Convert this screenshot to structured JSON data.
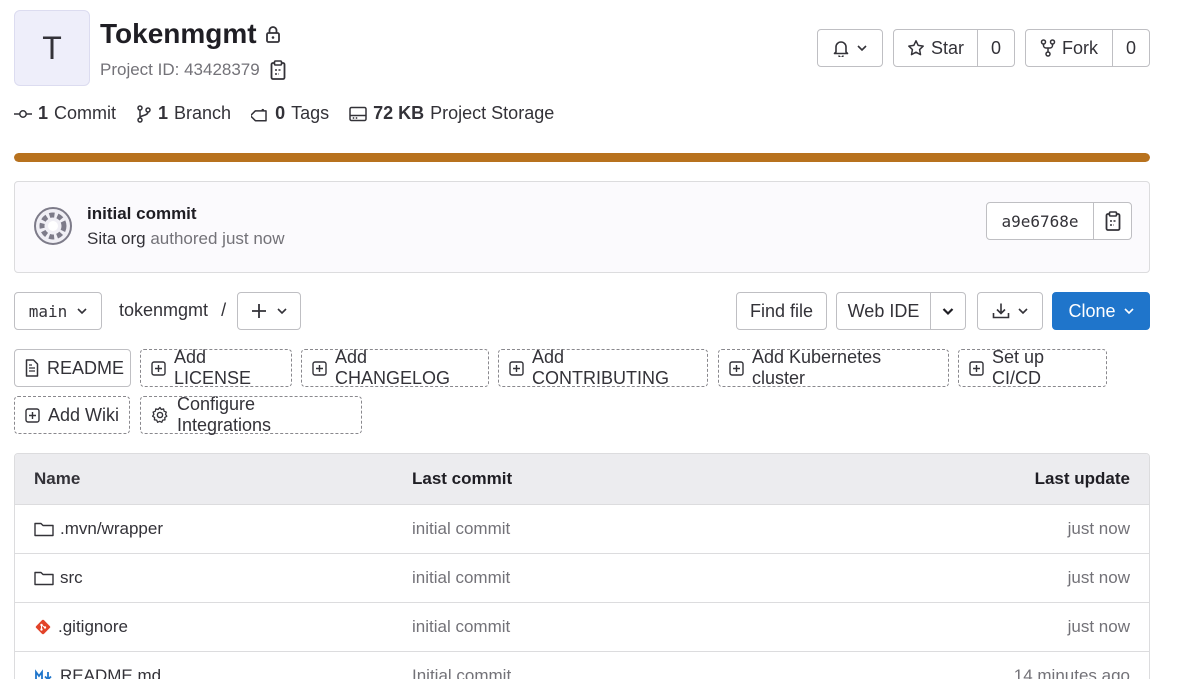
{
  "project": {
    "avatar_letter": "T",
    "name": "Tokenmgmt",
    "id_label": "Project ID: 43428379"
  },
  "header_actions": {
    "star_label": "Star",
    "star_count": "0",
    "fork_label": "Fork",
    "fork_count": "0"
  },
  "stats": {
    "commits_count": "1",
    "commits_label": "Commit",
    "branches_count": "1",
    "branches_label": "Branch",
    "tags_count": "0",
    "tags_label": "Tags",
    "storage_size": "72 KB",
    "storage_label": "Project Storage"
  },
  "storage_bar": {
    "fill_percent": 100,
    "color": "#b8721e"
  },
  "last_commit": {
    "message": "initial commit",
    "author": "Sita org",
    "time_text": "authored just now",
    "sha": "a9e6768e"
  },
  "repo_toolbar": {
    "branch": "main",
    "path": "tokenmgmt",
    "path_separator": "/",
    "find_file": "Find file",
    "web_ide": "Web IDE",
    "clone": "Clone"
  },
  "quick_actions": [
    "README",
    "Add LICENSE",
    "Add CHANGELOG",
    "Add CONTRIBUTING",
    "Add Kubernetes cluster",
    "Set up CI/CD",
    "Add Wiki",
    "Configure Integrations"
  ],
  "file_table": {
    "columns": [
      "Name",
      "Last commit",
      "Last update"
    ],
    "rows": [
      {
        "name": ".mvn/wrapper",
        "icon": "folder-icon",
        "last_commit": "initial commit",
        "last_update": "just now"
      },
      {
        "name": "src",
        "icon": "folder-icon",
        "last_commit": "initial commit",
        "last_update": "just now"
      },
      {
        "name": ".gitignore",
        "icon": "git-icon",
        "last_commit": "initial commit",
        "last_update": "just now"
      },
      {
        "name": "README.md",
        "icon": "markdown-icon",
        "last_commit": "Initial commit",
        "last_update": "14 minutes ago"
      }
    ]
  },
  "colors": {
    "primary": "#1f75cb",
    "storage_bar": "#b8721e",
    "git_icon": "#e24329"
  }
}
